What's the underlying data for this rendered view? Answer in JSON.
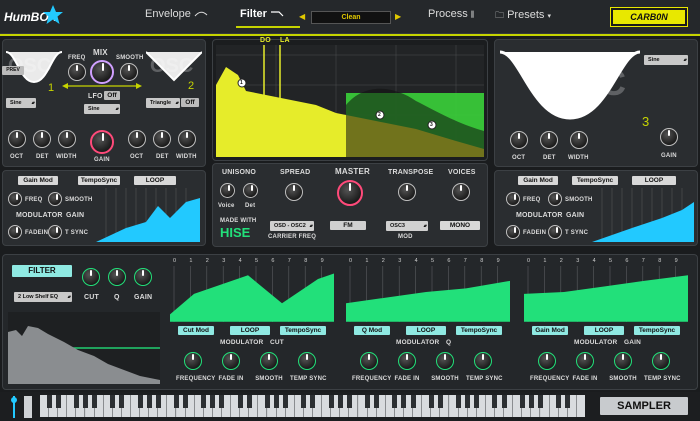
{
  "header": {
    "logo": "HumBOX",
    "tabs": [
      {
        "label": "Envelope"
      },
      {
        "label": "Filter"
      },
      {
        "label": "Process"
      },
      {
        "label": "Presets"
      }
    ],
    "preset": "Clean",
    "brand": "CARB0N"
  },
  "osc1": {
    "label": "OSC",
    "number": "1",
    "freq_label": "FREQ",
    "mix_label": "MIX",
    "smooth_label": "SMOOTH",
    "lfo_label": "LFO",
    "lfo_toggle": "Off",
    "lfo_wave": "Sine",
    "wave": "Sine",
    "knobs": [
      "OCT",
      "DET",
      "WIDTH"
    ],
    "gain_label": "GAIN",
    "modulator": {
      "buttons": [
        "Gain Mod",
        "TempoSync",
        "LOOP"
      ],
      "freq": "FREQ",
      "smooth": "SMOOTH",
      "title": "MODULATOR",
      "gain": "GAIN",
      "fadein": "FADEIN",
      "tsync": "T SYNC"
    }
  },
  "osc2": {
    "label": "OSC",
    "number": "2",
    "wave": "Triangle",
    "toggle": "Off",
    "knobs": [
      "OCT",
      "DET",
      "WIDTH"
    ]
  },
  "osc3": {
    "label": "OSC",
    "number": "3",
    "wave": "Sine",
    "knobs": [
      "OCT",
      "DET",
      "WIDTH"
    ],
    "gain_label": "GAIN",
    "modulator": {
      "buttons": [
        "Gain Mod",
        "TempoSync",
        "LOOP"
      ],
      "freq": "FREQ",
      "smooth": "SMOOTH",
      "title": "MODULATOR",
      "gain": "GAIN",
      "fadein": "FADEIN",
      "tsync": "T SYNC"
    }
  },
  "spectrum": {
    "top_labels": [
      "DO",
      "LA"
    ],
    "bottom_labels": [
      "C",
      "A"
    ],
    "points": [
      "1",
      "2",
      "3"
    ]
  },
  "unison": {
    "unisono": "UNISONO",
    "spread": "SPREAD",
    "master": "MASTER",
    "transpose": "TRANSPOSE",
    "voices": "VOICES",
    "voice": "Voice",
    "det": "Det",
    "made_with": "MADE WITH",
    "hise": "HISE",
    "carrier_select": "OSD - OSC2",
    "carrier_freq": "CARRIER FREQ",
    "fm": "FM",
    "mod_select": "OSC3",
    "mod": "MOD",
    "mono": "MONO"
  },
  "filter": {
    "title": "FILTER",
    "type": "2 Low Shelf EQ",
    "cut": "CUT",
    "q": "Q",
    "gain": "GAIN"
  },
  "modulators": [
    {
      "buttons": [
        "Cut Mod",
        "LOOP",
        "TempoSync"
      ],
      "title": "MODULATOR",
      "target": "CUT",
      "knobs": [
        "FREQUENCY",
        "FADE IN",
        "SMOOTH",
        "TEMP SYNC"
      ]
    },
    {
      "buttons": [
        "Q Mod",
        "LOOP",
        "TempoSync"
      ],
      "title": "MODULATOR",
      "target": "Q",
      "knobs": [
        "FREQUENCY",
        "FADE IN",
        "SMOOTH",
        "TEMP SYNC"
      ]
    },
    {
      "buttons": [
        "Gain Mod",
        "LOOP",
        "TempoSync"
      ],
      "title": "MODULATOR",
      "target": "GAIN",
      "knobs": [
        "FREQUENCY",
        "FADE IN",
        "SMOOTH",
        "TEMP SYNC"
      ]
    }
  ],
  "step_ticks": [
    "0",
    "1",
    "2",
    "3",
    "4",
    "5",
    "6",
    "7",
    "8",
    "9"
  ],
  "sampler": "SAMPLER",
  "colors": {
    "accent_yellow": "#c6d400",
    "accent_green": "#22e07a",
    "accent_cyan": "#22c9ff",
    "accent_pink": "#ff4a7a"
  }
}
